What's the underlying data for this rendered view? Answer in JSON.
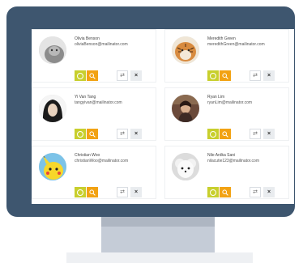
{
  "users": [
    {
      "name": "Olivia Benson",
      "email": "oliviaBenson@mailinator.com",
      "avatar_icon": "grey-cat-avatar-icon"
    },
    {
      "name": "Meredith Green",
      "email": "meredithGreen@mailinator.com",
      "avatar_icon": "tiger-avatar-icon"
    },
    {
      "name": "Yi Van Tang",
      "email": "tangyivan@mailinator.com",
      "avatar_icon": "dark-hair-person-avatar-icon"
    },
    {
      "name": "Ryan Lim",
      "email": "ryanLim@mailinator.com",
      "avatar_icon": "person-portrait-avatar-icon"
    },
    {
      "name": "Christian Woo",
      "email": "christianWoo@mailinator.com",
      "avatar_icon": "yellow-cartoon-avatar-icon"
    },
    {
      "name": "Nile Ardka Sani",
      "email": "nilacutie123@mailinator.com",
      "avatar_icon": "white-dog-avatar-icon"
    }
  ],
  "buttons": {
    "approve_icon": "circle-check-icon",
    "search_icon": "magnifier-icon",
    "swap_glyph": "⇄",
    "remove_glyph": "×"
  },
  "colors": {
    "monitor_frame": "#3e566f",
    "approve_button": "#c8cf2d",
    "search_button": "#f2a213",
    "stand": "#c5ccd7"
  }
}
